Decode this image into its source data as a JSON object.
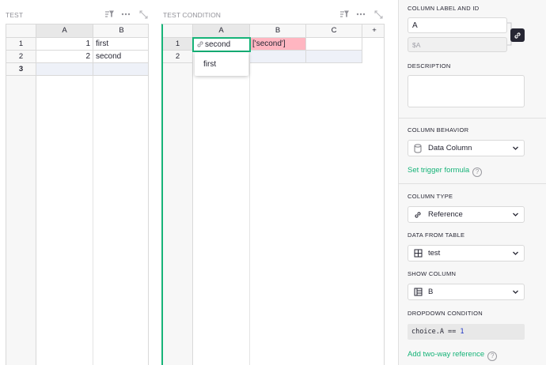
{
  "left_widget": {
    "title": "TEST",
    "columns": [
      "A",
      "B"
    ],
    "rows": [
      {
        "num": "1",
        "a": "1",
        "b": "first"
      },
      {
        "num": "2",
        "a": "2",
        "b": "second"
      }
    ],
    "add_row_num": "3"
  },
  "right_widget": {
    "title": "TEST CONDITION",
    "columns": [
      "A",
      "B",
      "C"
    ],
    "add_column": "+",
    "rows": [
      {
        "num": "1",
        "a": "second",
        "b": "['second']",
        "c": ""
      },
      {
        "num": "2",
        "a": "",
        "b": "",
        "c": ""
      }
    ],
    "dropdown_options": [
      "first"
    ]
  },
  "panel": {
    "column_label_heading": "COLUMN LABEL AND ID",
    "label_value": "A",
    "id_placeholder": "$A",
    "description_heading": "DESCRIPTION",
    "description_value": "",
    "behavior_heading": "COLUMN BEHAVIOR",
    "behavior_value": "Data Column",
    "trigger_link": "Set trigger formula",
    "type_heading": "COLUMN TYPE",
    "type_value": "Reference",
    "data_from_heading": "DATA FROM TABLE",
    "data_from_value": "test",
    "show_column_heading": "SHOW COLUMN",
    "show_column_value": "B",
    "dropdown_heading": "DROPDOWN CONDITION",
    "dropdown_code_prefix": "choice.A == ",
    "dropdown_code_value": "1",
    "two_way_link": "Add two-way reference"
  },
  "colors": {
    "accent": "#16b378",
    "error_cell": "#ffb6c1",
    "add_row": "#eef1f8"
  },
  "icons": [
    "sort-filter-icon",
    "more-icon",
    "expand-icon",
    "link-icon",
    "database-icon",
    "table-icon",
    "column-icon",
    "help-icon",
    "chevron-down-icon"
  ]
}
